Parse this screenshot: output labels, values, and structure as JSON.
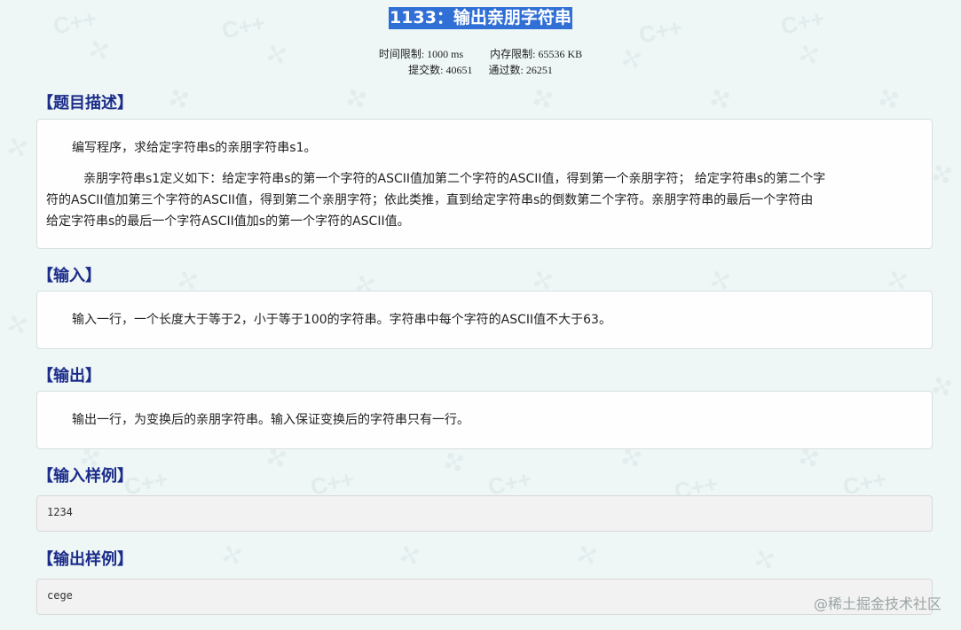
{
  "problem": {
    "title": "1133：输出亲朋字符串",
    "limits": {
      "time_label": "时间限制: 1000 ms",
      "memory_label": "内存限制: 65536 KB",
      "submit_label": "提交数: 40651",
      "pass_label": "通过数: 26251"
    }
  },
  "sections": {
    "description": {
      "heading": "【题目描述】",
      "para1": "编写程序，求给定字符串s的亲朋字符串s1。",
      "para2_line1": "亲朋字符串s1定义如下：给定字符串s的第一个字符的ASCII值加第二个字符的ASCII值，得到第一个亲朋字符；  给定字符串s的第二个字",
      "para2_line2": "符的ASCII值加第三个字符的ASCII值，得到第二个亲朋字符；依此类推，直到给定字符串s的倒数第二个字符。亲朋字符串的最后一个字符由",
      "para2_line3": "给定字符串s的最后一个字符ASCII值加s的第一个字符的ASCII值。"
    },
    "input": {
      "heading": "【输入】",
      "text": "输入一行，一个长度大于等于2，小于等于100的字符串。字符串中每个字符的ASCII值不大于63。"
    },
    "output": {
      "heading": "【输出】",
      "text": "输出一行，为变换后的亲朋字符串。输入保证变换后的字符串只有一行。"
    },
    "sample_input": {
      "heading": "【输入样例】",
      "code": "1234"
    },
    "sample_output": {
      "heading": "【输出样例】",
      "code": "cege"
    }
  },
  "watermark_text": "@稀土掘金技术社区",
  "colors": {
    "title_bg": "#2f6fd6",
    "heading": "#1b2c8a",
    "page_bg": "#eef6f6"
  }
}
